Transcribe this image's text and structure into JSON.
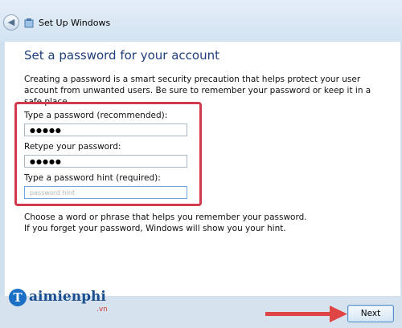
{
  "window": {
    "title": "Set Up Windows"
  },
  "page": {
    "heading": "Set a password for your account",
    "description": "Creating a password is a smart security precaution that helps protect your user account from unwanted users. Be sure to remember your password or keep it in a safe place."
  },
  "form": {
    "password_label": "Type a password (recommended):",
    "password_value": "●●●●●",
    "retype_label": "Retype your password:",
    "retype_value": "●●●●●",
    "hint_label": "Type a password hint (required):",
    "hint_value": "password hint"
  },
  "help": {
    "line1": "Choose a word or phrase that helps you remember your password.",
    "line2": "If you forget your password, Windows will show you your hint."
  },
  "footer": {
    "next_label": "Next"
  },
  "watermark": {
    "brand": "aimienphi",
    "brand_initial": "T",
    "tld": ".vn"
  },
  "colors": {
    "heading": "#1f3e7a",
    "highlight": "#d13a4b",
    "footer": "#d6e3ef",
    "arrow": "#e04545"
  }
}
